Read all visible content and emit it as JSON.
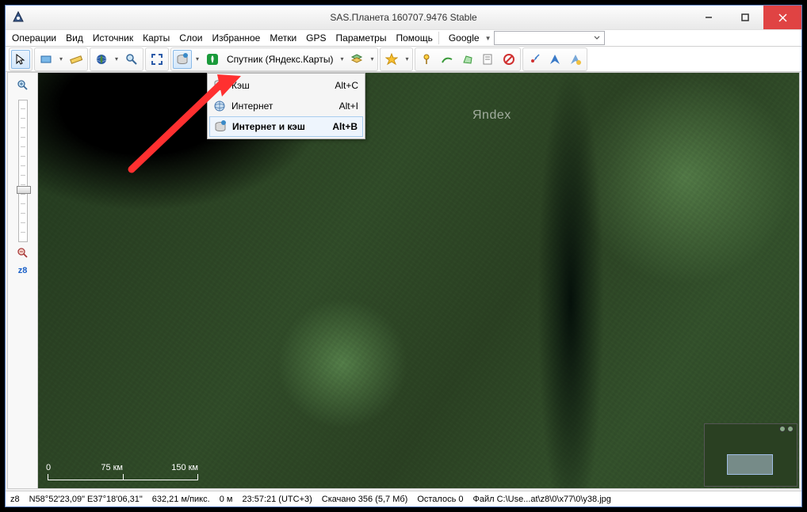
{
  "title": "SAS.Планета 160707.9476 Stable",
  "menubar": {
    "items": [
      "Операции",
      "Вид",
      "Источник",
      "Карты",
      "Слои",
      "Избранное",
      "Метки",
      "GPS",
      "Параметры",
      "Помощь"
    ]
  },
  "search": {
    "provider": "Google",
    "value": ""
  },
  "toolbar": {
    "map_label": "Спутник (Яндекс.Карты)"
  },
  "dropdown": {
    "items": [
      {
        "label": "Кэш",
        "accel": "Alt+C",
        "selected": false
      },
      {
        "label": "Интернет",
        "accel": "Alt+I",
        "selected": false
      },
      {
        "label": "Интернет и кэш",
        "accel": "Alt+B",
        "selected": true
      }
    ]
  },
  "map": {
    "watermark": "Яndex",
    "scale": {
      "labels": [
        "0",
        "75 км",
        "150 км"
      ]
    }
  },
  "left": {
    "zoom_label": "z8"
  },
  "status": {
    "zoom": "z8",
    "coords": "N58°52'23,09\" E37°18'06,31\"",
    "mpp": "632,21 м/пикс.",
    "elev": "0 м",
    "time": "23:57:21 (UTC+3)",
    "downloaded": "Скачано 356 (5,7 Мб)",
    "remaining": "Осталось 0",
    "file": "Файл C:\\Use...at\\z8\\0\\x77\\0\\y38.jpg"
  }
}
